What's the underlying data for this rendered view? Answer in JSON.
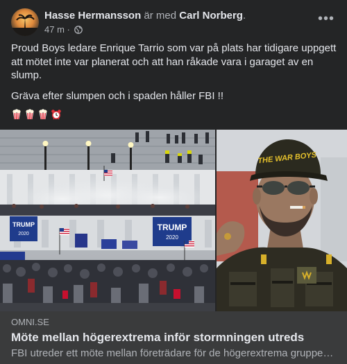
{
  "post": {
    "author": "Hasse Hermansson",
    "connector": " är med ",
    "tagged": "Carl Norberg",
    "period": ".",
    "time": "47 m",
    "dot": " · ",
    "more": "•••",
    "paragraphs": [
      "Proud Boys ledare Enrique Tarrio som var på plats har tidigare uppgett att mötet inte var planerat och att han råkade vara i garaget av en slump.",
      "Gräva efter slumpen och i spaden håller FBI !!"
    ],
    "emojis": [
      "popcorn-icon",
      "popcorn-icon",
      "popcorn-icon",
      "alarm-clock-icon"
    ]
  },
  "photos": {
    "left": {
      "signs": [
        "TRUMP",
        "2020",
        "TRUMP",
        "2020",
        "TRUMP"
      ]
    },
    "right": {
      "cap_text": "THE WAR BOYS"
    }
  },
  "link": {
    "domain": "OMNI.SE",
    "title": "Möte mellan högerextrema inför stormningen utreds",
    "description": "FBI utreder ett möte mellan företrädare för de högerextrema grupperingarna"
  },
  "colors": {
    "background": "#242526",
    "preview_background": "#3a3b3c",
    "primary_text": "#e4e6eb",
    "secondary_text": "#b0b3b8"
  }
}
